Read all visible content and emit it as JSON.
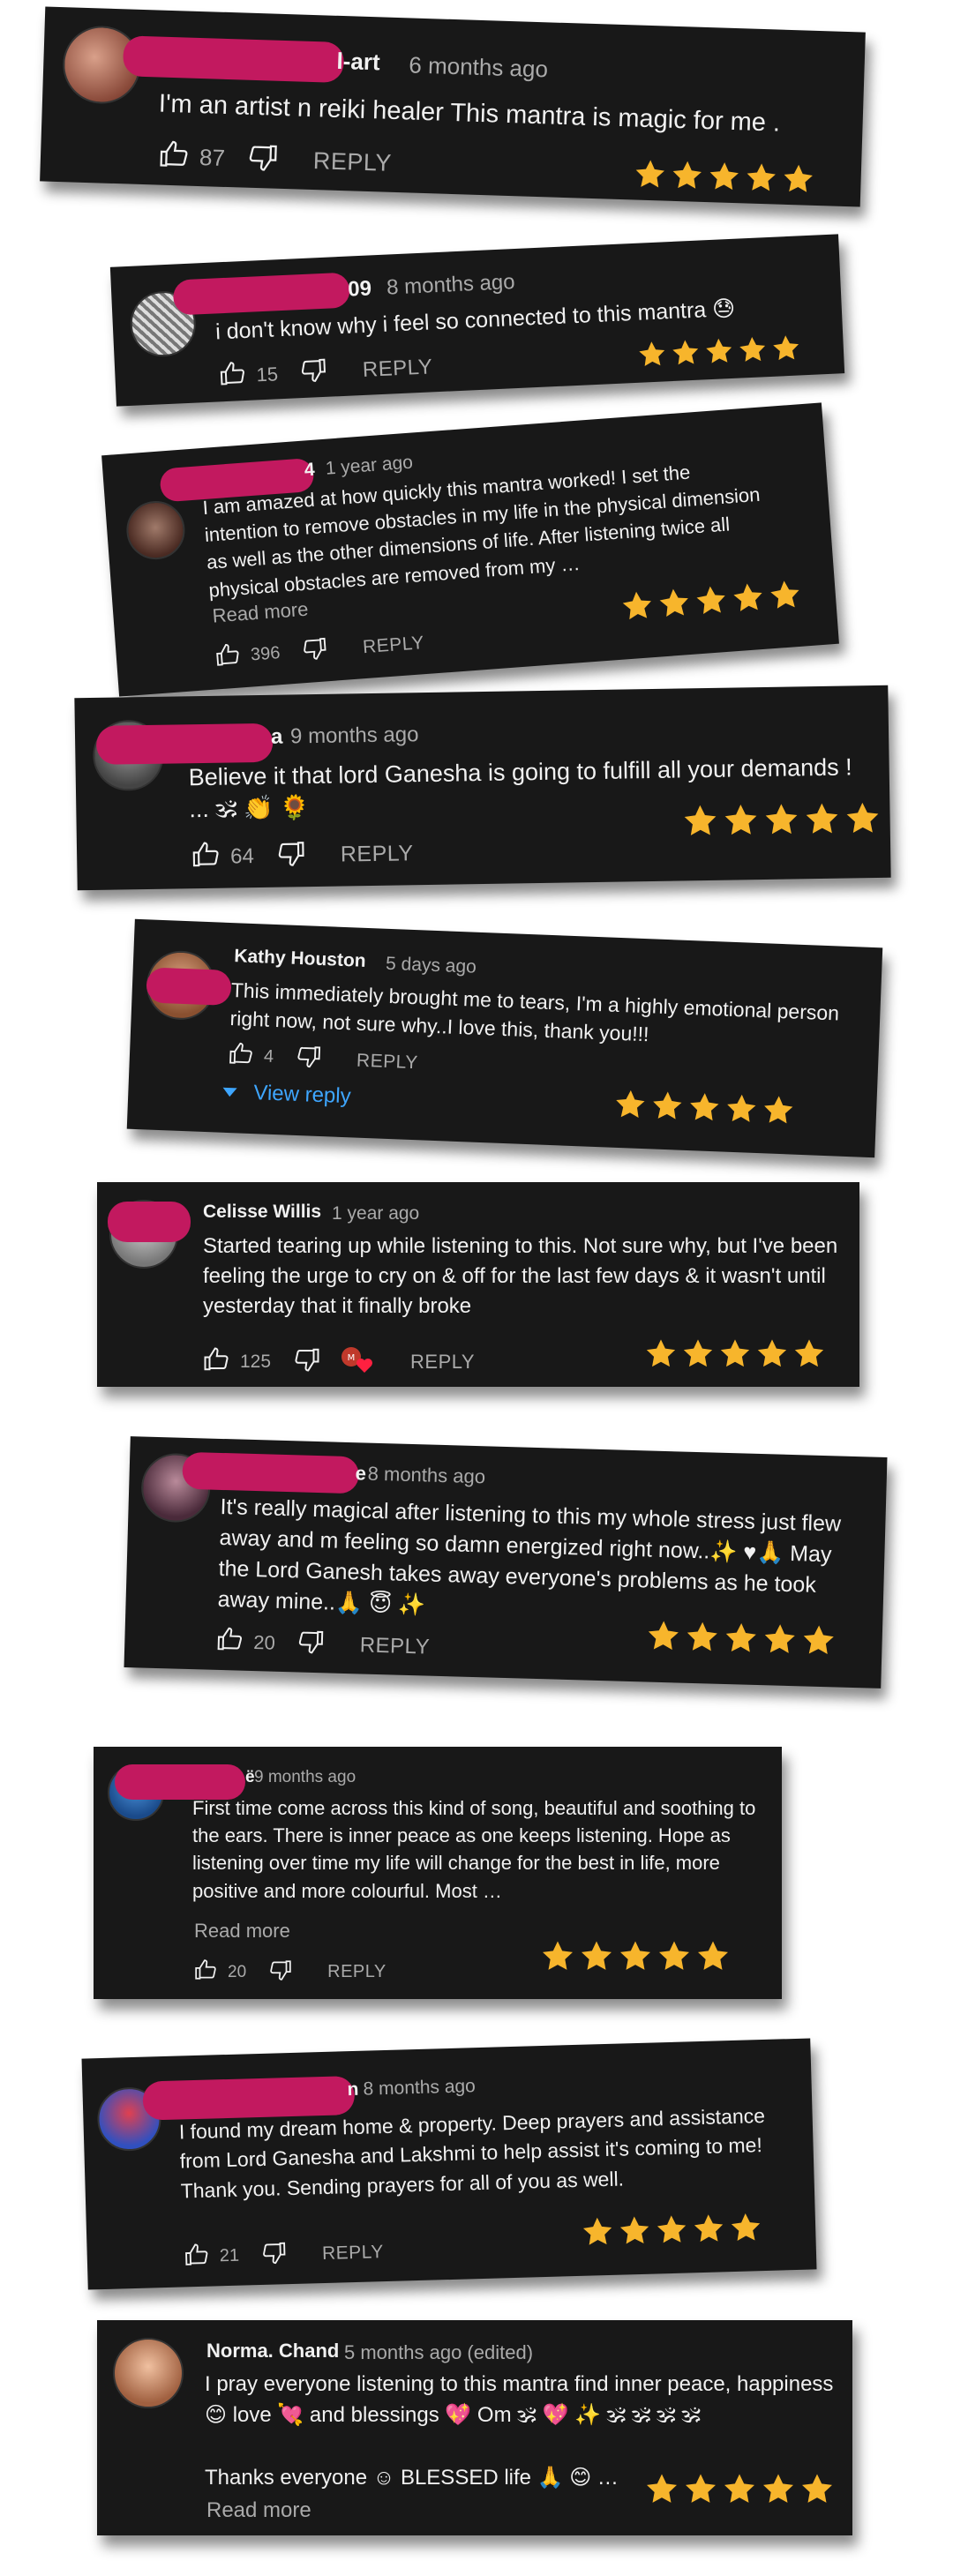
{
  "comments": [
    {
      "name": "l-art",
      "time": "6 months ago",
      "text": "I'm an artist n reiki healer This mantra is magic for me .",
      "likes": "87",
      "reply": "REPLY",
      "stars": 5
    },
    {
      "name": "09",
      "time": "8 months ago",
      "text": "i don't know why i feel so connected to this mantra 😓",
      "likes": "15",
      "reply": "REPLY",
      "stars": 5
    },
    {
      "name": "4",
      "time": "1 year ago",
      "text": "I am amazed at how quickly this mantra worked! I set the intention to remove obstacles in my life in the physical dimension as well as the other dimensions of life. After listening twice all physical obstacles are removed from my …",
      "read_more": "Read more",
      "likes": "396",
      "reply": "REPLY",
      "stars": 5
    },
    {
      "name": "a",
      "time": "9 months ago",
      "text": "Believe it that lord Ganesha is going to fulfill all your demands ! ... 🕉 👏 🌻",
      "likes": "64",
      "reply": "REPLY",
      "stars": 5
    },
    {
      "name": "Kathy Houston",
      "time": "5 days ago",
      "text": "This immediately brought me to tears, I'm a highly emotional person right now, not sure why..I love this, thank you!!!",
      "likes": "4",
      "reply": "REPLY",
      "view_reply": "View reply",
      "stars": 5
    },
    {
      "name": "Celisse Willis",
      "time": "1 year ago",
      "text": "Started tearing up while listening to this. Not sure why, but I've been feeling the urge to cry on & off for the last few days & it wasn't until yesterday that it finally broke",
      "likes": "125",
      "reply": "REPLY",
      "stars": 5
    },
    {
      "name": "e",
      "time": "8 months ago",
      "text": "It's really magical after listening to this my whole stress just flew away and m feeling so damn energized right now..✨ ♥🙏 May the Lord Ganesh takes away everyone's problems as he took away mine..🙏 😇 ✨",
      "likes": "20",
      "reply": "REPLY",
      "stars": 5
    },
    {
      "name": "ë",
      "time": "9 months ago",
      "text": "First time come across this kind of song, beautiful and soothing to the ears. There is inner peace as one keeps listening. Hope as listening over time my life will change for the best in life, more positive and more colourful. Most …",
      "read_more": "Read more",
      "likes": "20",
      "reply": "REPLY",
      "stars": 5
    },
    {
      "name": "n",
      "time": "8 months ago",
      "text": "I found my dream home & property. Deep prayers and assistance from Lord Ganesha and Lakshmi to help assist it's coming to me!  Thank you. Sending prayers for all of you as well.",
      "likes": "21",
      "reply": "REPLY",
      "stars": 5
    },
    {
      "name": "Norma. Chand",
      "time": "5 months ago (edited)",
      "text": "I pray everyone listening to this mantra find inner peace, happiness 😊  love 💘  and blessings 💖  Om 🕉 💖  ✨  🕉 🕉 🕉 🕉",
      "text2": "Thanks everyone ☺ BLESSED life 🙏  😊 …",
      "read_more": "Read more",
      "stars": 5
    }
  ],
  "colors": {
    "card_bg": "#181818",
    "star": "#f7b52c",
    "redaction": "#c2195f",
    "link": "#3ea6ff"
  },
  "icons": {
    "like": "thumbs-up-icon",
    "dislike": "thumbs-down-icon",
    "star": "star-icon",
    "heart": "creator-heart-icon"
  }
}
